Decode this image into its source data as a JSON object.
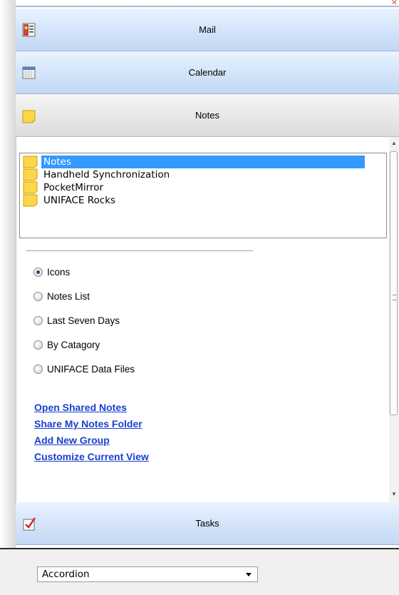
{
  "headers": {
    "mail": "Mail",
    "calendar": "Calendar",
    "notes": "Notes",
    "tasks": "Tasks"
  },
  "notes_list": [
    {
      "label": "Notes",
      "selected": true
    },
    {
      "label": "Handheld Synchronization",
      "selected": false
    },
    {
      "label": "PocketMirror",
      "selected": false
    },
    {
      "label": "UNIFACE Rocks",
      "selected": false
    }
  ],
  "views": [
    {
      "label": "Icons",
      "checked": true
    },
    {
      "label": "Notes List",
      "checked": false
    },
    {
      "label": "Last Seven Days",
      "checked": false
    },
    {
      "label": "By Catagory",
      "checked": false
    },
    {
      "label": "UNIFACE Data Files",
      "checked": false
    }
  ],
  "links": [
    "Open Shared Notes",
    "Share My Notes Folder",
    "Add New Group",
    "Customize Current View"
  ],
  "style_combo": {
    "value": "Accordion"
  },
  "colors": {
    "selection": "#3399ff",
    "link": "#1a3fd1",
    "header_blue": "#c3d8f3"
  }
}
